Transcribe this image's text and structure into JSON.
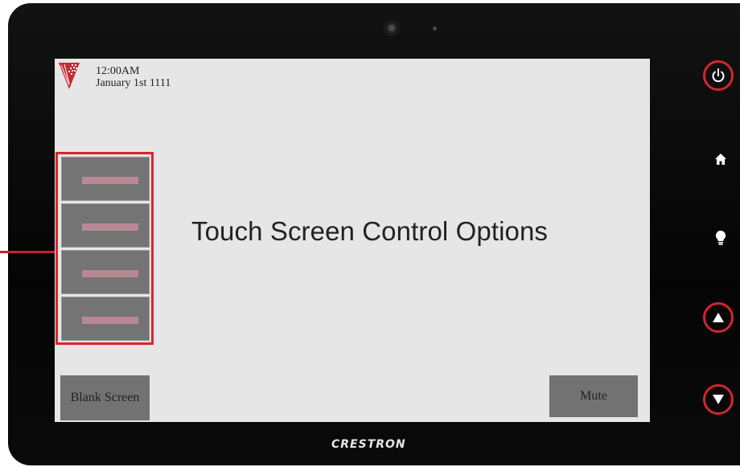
{
  "screen": {
    "time": "12:00AM",
    "date": "January 1st 1111",
    "title": "Touch Screen Control Options",
    "stack_buttons": [
      {
        "label": ""
      },
      {
        "label": ""
      },
      {
        "label": ""
      },
      {
        "label": ""
      }
    ],
    "blank_screen_label": "Blank Screen",
    "mute_label": "Mute"
  },
  "hardware": {
    "brand": "CRESTRON",
    "buttons": [
      "power-icon",
      "home-icon",
      "lightbulb-icon",
      "triangle-up-icon",
      "triangle-down-icon"
    ]
  },
  "colors": {
    "highlight": "#d5252c",
    "screen_bg": "#e6e6e6",
    "button_gray": "#747474",
    "bar_pink": "#b88994"
  }
}
